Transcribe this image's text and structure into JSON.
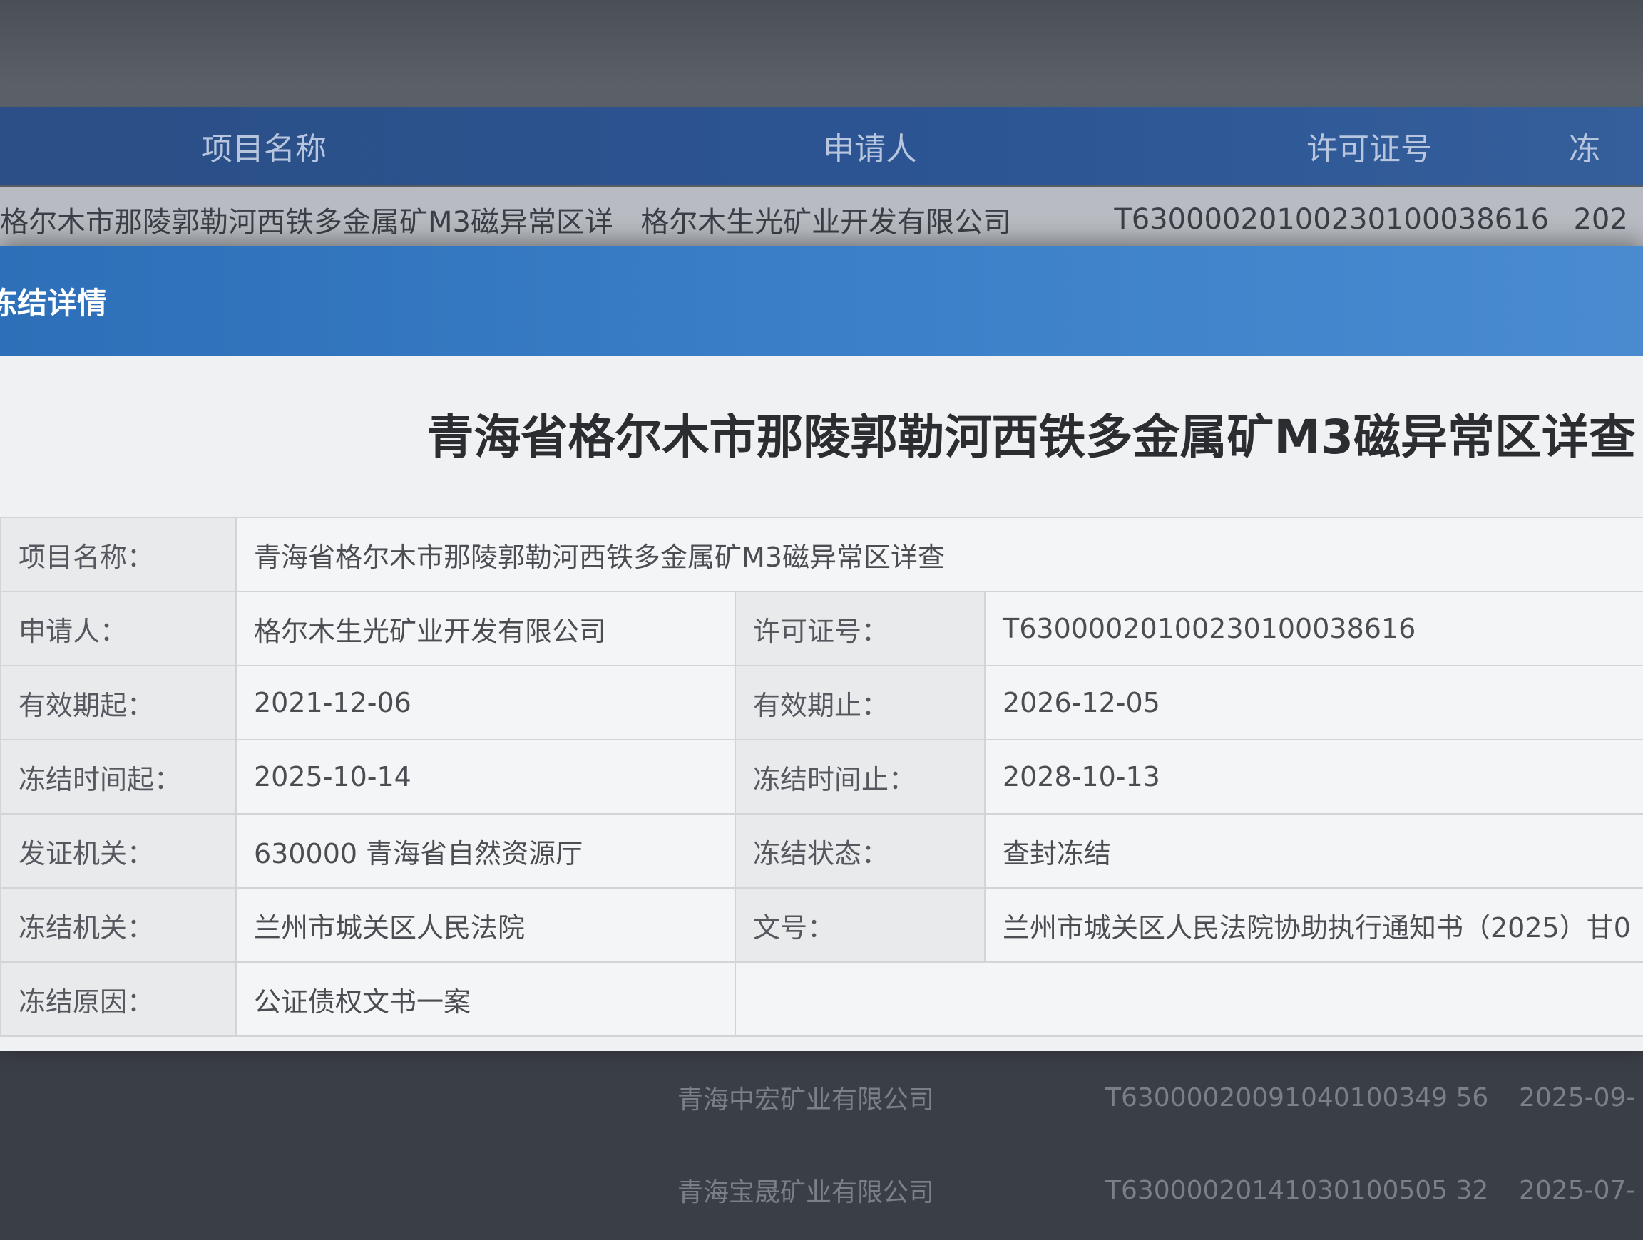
{
  "background_table": {
    "headers": [
      "项目名称",
      "申请人",
      "许可证号",
      "冻"
    ],
    "visible_row": {
      "project": "格尔木市那陵郭勒河西铁多金属矿M3磁异常区详",
      "applicant": "格尔木生光矿业开发有限公司",
      "license": "T63000020100230100038616",
      "date": "202"
    },
    "bottom_rows": [
      {
        "applicant": "青海中宏矿业有限公司",
        "license": "T63000020091040100349 56",
        "date": "2025-09-"
      },
      {
        "applicant": "青海宝晟矿业有限公司",
        "license": "T63000020141030100505 32",
        "date": "2025-07-"
      }
    ]
  },
  "modal": {
    "title": "冻结详情",
    "heading": "青海省格尔木市那陵郭勒河西铁多金属矿M3磁异常区详查",
    "fields": {
      "project_name_label": "项目名称：",
      "project_name": "青海省格尔木市那陵郭勒河西铁多金属矿M3磁异常区详查",
      "applicant_label": "申请人：",
      "applicant": "格尔木生光矿业开发有限公司",
      "license_label": "许可证号：",
      "license": "T63000020100230100038616",
      "valid_from_label": "有效期起：",
      "valid_from": "2021-12-06",
      "valid_to_label": "有效期止：",
      "valid_to": "2026-12-05",
      "freeze_from_label": "冻结时间起：",
      "freeze_from": "2025-10-14",
      "freeze_to_label": "冻结时间止：",
      "freeze_to": "2028-10-13",
      "issuer_label": "发证机关：",
      "issuer": "630000 青海省自然资源厅",
      "freeze_status_label": "冻结状态：",
      "freeze_status": "查封冻结",
      "freeze_authority_label": "冻结机关：",
      "freeze_authority": "兰州市城关区人民法院",
      "doc_no_label": "文号：",
      "doc_no": "兰州市城关区人民法院协助执行通知书（2025）甘0",
      "freeze_reason_label": "冻结原因：",
      "freeze_reason": "公证债权文书一案"
    }
  }
}
